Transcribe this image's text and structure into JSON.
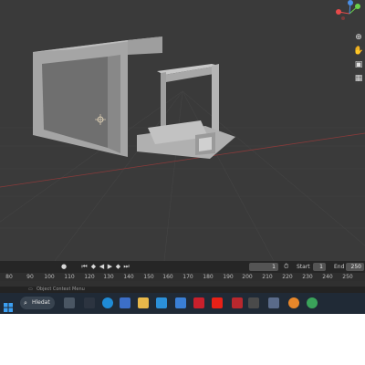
{
  "timeline": {
    "current_frame": "1",
    "start_label": "Start",
    "start_value": "1",
    "end_label": "End",
    "end_value": "250",
    "ruler_ticks": [
      "80",
      "90",
      "100",
      "110",
      "120",
      "130",
      "140",
      "150",
      "160",
      "170",
      "180",
      "190",
      "200",
      "210",
      "220",
      "230",
      "240",
      "250"
    ]
  },
  "status_bar": {
    "context_menu_label": "Object Context Menu"
  },
  "taskbar": {
    "search_label": "Hledat",
    "icons": [
      "windows-start",
      "task-view",
      "edge",
      "file-explorer",
      "store",
      "mail",
      "mcafee",
      "youtube",
      "app",
      "settings",
      "blender",
      "chrome"
    ]
  },
  "gizmo": {
    "axis_x_color": "#e64a4a",
    "axis_y_color": "#6ad04a",
    "axis_z_color": "#4a8fe6"
  }
}
